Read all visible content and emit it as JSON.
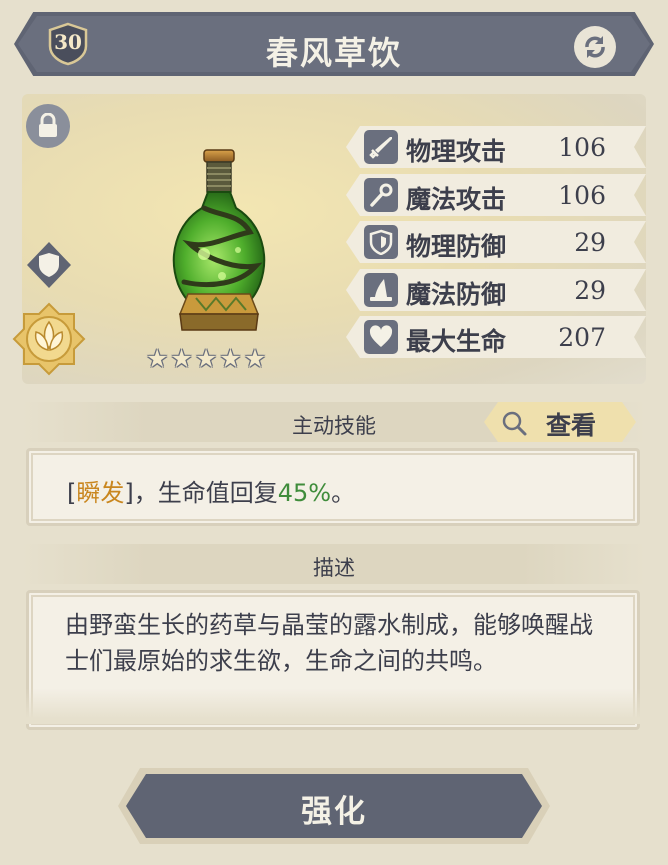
{
  "header": {
    "title": "春风草饮",
    "level": "30",
    "level_icon": "shield-badge-icon",
    "swap_icon": "swap-arrows-icon"
  },
  "item": {
    "image": "green-potion-bottle",
    "rarity_stars": 5,
    "star_glyph": "★",
    "lock_icon": "lock-icon",
    "slot_icon": "shield-icon",
    "emblem_icon": "lotus-emblem-icon"
  },
  "stats": [
    {
      "label": "物理攻击",
      "value": "106",
      "icon": "sword-icon"
    },
    {
      "label": "魔法攻击",
      "value": "106",
      "icon": "wand-icon"
    },
    {
      "label": "物理防御",
      "value": "29",
      "icon": "shield-icon"
    },
    {
      "label": "魔法防御",
      "value": "29",
      "icon": "wizard-hat-icon"
    },
    {
      "label": "最大生命",
      "value": "207",
      "icon": "heart-icon"
    }
  ],
  "skill": {
    "header": "主动技能",
    "view_label": "查看",
    "text_open_bracket": "[",
    "text_tag": "瞬发",
    "text_close_bracket": "]",
    "text_middle": "，生命值回复",
    "text_percent": "45%",
    "text_end": "。"
  },
  "description": {
    "header": "描述",
    "text": "由野蛮生长的药草与晶莹的露水制成，能够唤醒战士们最原始的求生欲，生命之间的共鸣。"
  },
  "actions": {
    "enhance_label": "强化"
  },
  "colors": {
    "banner": "#6a6f7e",
    "background": "#e6e0cd",
    "skill_tag": "#c9861e",
    "skill_percent": "#3f8c3b"
  }
}
